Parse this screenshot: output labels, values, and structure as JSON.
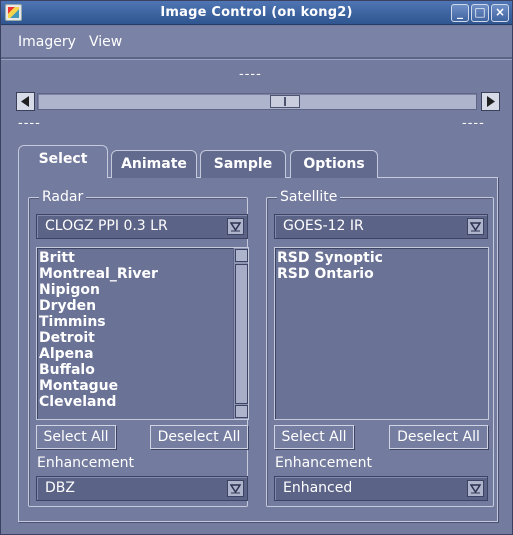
{
  "window": {
    "title": "Image Control (on kong2)",
    "controls": [
      "_",
      "□",
      "×"
    ]
  },
  "menu": [
    "Imagery",
    "View"
  ],
  "time_slider": {
    "center_label": "----",
    "left_label": "----",
    "right_label": "----",
    "position": 0.5
  },
  "tabs": [
    "Select",
    "Animate",
    "Sample",
    "Options"
  ],
  "active_tab": "Select",
  "radar": {
    "group_label": "Radar",
    "selected_product": "CLOGZ PPI 0.3 LR",
    "sites": [
      "Britt",
      "Montreal_River",
      "Nipigon",
      "Dryden",
      "Timmins",
      "Detroit",
      "Alpena",
      "Buffalo",
      "Montague",
      "Cleveland"
    ],
    "select_all": "Select All",
    "deselect_all": "Deselect All",
    "enhancement_label": "Enhancement",
    "enhancement_value": "DBZ"
  },
  "satellite": {
    "group_label": "Satellite",
    "selected_product": "GOES-12 IR",
    "sectors": [
      "RSD Synoptic",
      "RSD Ontario"
    ],
    "select_all": "Select All",
    "deselect_all": "Deselect All",
    "enhancement_label": "Enhancement",
    "enhancement_value": "Enhanced"
  }
}
